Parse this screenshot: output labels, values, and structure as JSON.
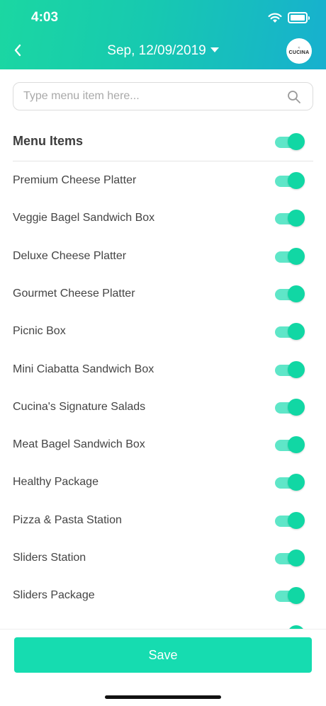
{
  "status_bar": {
    "time": "4:03"
  },
  "header": {
    "date": "Sep, 12/09/2019",
    "logo_text": "CUCINA"
  },
  "search": {
    "placeholder": "Type menu item here..."
  },
  "section": {
    "title": "Menu Items",
    "all_enabled": true
  },
  "menu_items": [
    {
      "label": "Premium Cheese Platter",
      "enabled": true
    },
    {
      "label": "Veggie Bagel Sandwich Box",
      "enabled": true
    },
    {
      "label": "Deluxe Cheese Platter",
      "enabled": true
    },
    {
      "label": "Gourmet Cheese Platter",
      "enabled": true
    },
    {
      "label": "Picnic Box",
      "enabled": true
    },
    {
      "label": "Mini Ciabatta Sandwich Box",
      "enabled": true
    },
    {
      "label": "Cucina's Signature Salads",
      "enabled": true
    },
    {
      "label": "Meat Bagel Sandwich Box",
      "enabled": true
    },
    {
      "label": "Healthy Package",
      "enabled": true
    },
    {
      "label": "Pizza & Pasta Station",
      "enabled": true
    },
    {
      "label": "Sliders Station",
      "enabled": true
    },
    {
      "label": "Sliders Package",
      "enabled": true
    },
    {
      "label": "",
      "enabled": true
    }
  ],
  "footer": {
    "save_label": "Save"
  },
  "colors": {
    "header_start": "#1bd7a2",
    "header_end": "#17b0cf",
    "toggle_on": "#11d7a4",
    "save_button": "#16dcb0"
  }
}
